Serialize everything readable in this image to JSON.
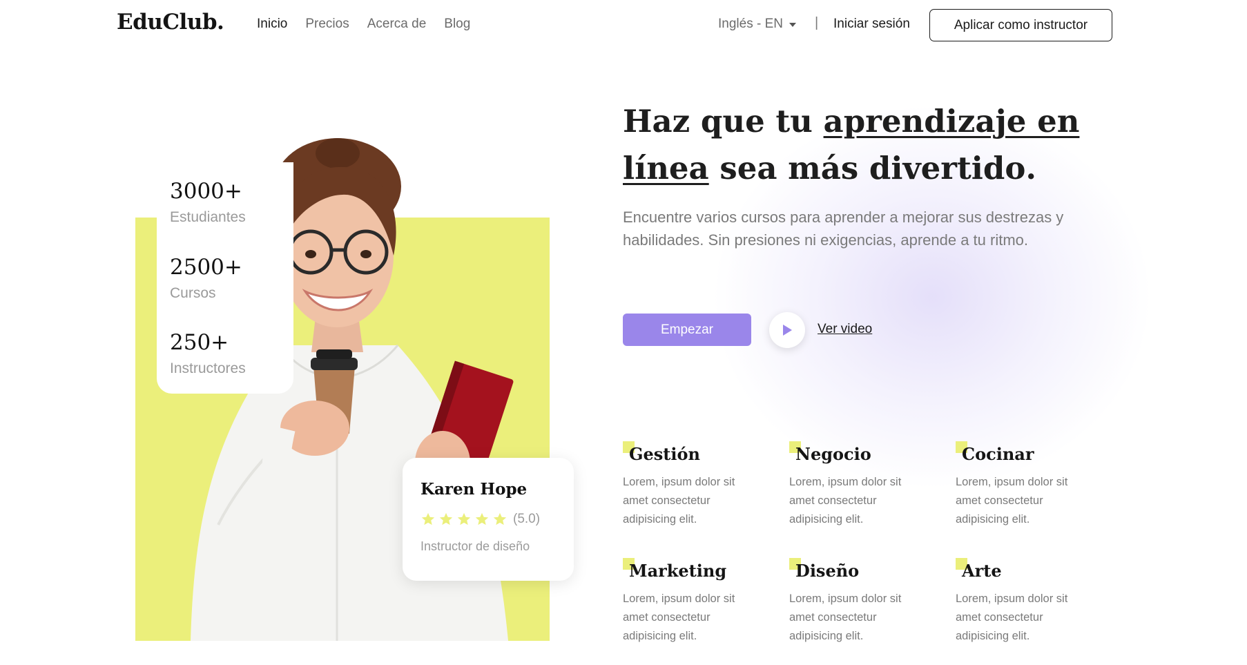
{
  "nav": {
    "logo": "EduClub.",
    "links": [
      {
        "label": "Inicio"
      },
      {
        "label": "Precios"
      },
      {
        "label": "Acerca de"
      },
      {
        "label": "Blog"
      }
    ],
    "language": "Inglés - EN",
    "separator": "|",
    "login": "Iniciar sesión",
    "apply_button": "Aplicar como instructor"
  },
  "stats": [
    {
      "value": "3000+",
      "label": "Estudiantes"
    },
    {
      "value": "2500+",
      "label": "Cursos"
    },
    {
      "value": "250+",
      "label": "Instructores"
    }
  ],
  "instructor": {
    "name": "Karen Hope",
    "rating": "(5.0)",
    "stars": 5,
    "role": "Instructor de diseño"
  },
  "hero": {
    "headline_part1": "Haz que tu ",
    "headline_highlight1": "aprendizaje en",
    "headline_highlight2": "línea",
    "headline_part2": " sea más divertido",
    "headline_end": ".",
    "subtitle": "Encuentre varios cursos para aprender a mejorar sus destrezas y habilidades. Sin presiones ni exigencias, aprende a tu ritmo.",
    "cta": "Empezar",
    "video_link": "Ver video"
  },
  "categories": [
    {
      "title": "Gestión",
      "desc": "Lorem, ipsum dolor sit amet consectetur adipisicing elit."
    },
    {
      "title": "Negocio",
      "desc": "Lorem, ipsum dolor sit amet consectetur adipisicing elit."
    },
    {
      "title": "Cocinar",
      "desc": "Lorem, ipsum dolor sit amet consectetur adipisicing elit."
    },
    {
      "title": "Marketing",
      "desc": "Lorem, ipsum dolor sit amet consectetur adipisicing elit."
    },
    {
      "title": "Diseño",
      "desc": "Lorem, ipsum dolor sit amet consectetur adipisicing elit."
    },
    {
      "title": "Arte",
      "desc": "Lorem, ipsum dolor sit amet consectetur adipisicing elit."
    }
  ],
  "colors": {
    "accent_yellow": "#ebef7b",
    "accent_purple": "#9a86ea",
    "text_dark": "#1e1e1e",
    "text_muted": "#7a7a7a"
  }
}
